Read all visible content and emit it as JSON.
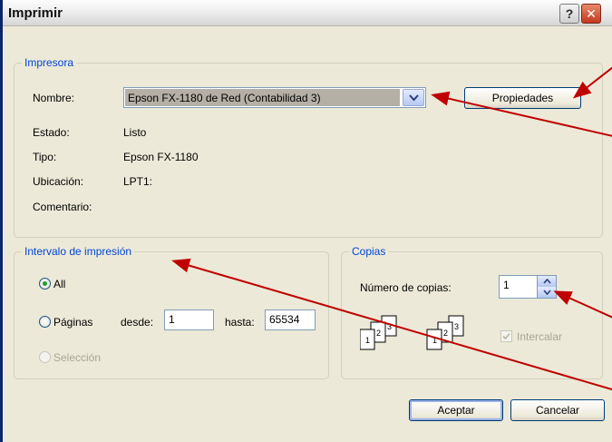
{
  "window": {
    "title": "Imprimir",
    "help_glyph": "?",
    "close_glyph": "✕"
  },
  "printer": {
    "group_label": "Impresora",
    "name_label": "Nombre:",
    "name_value": "Epson FX-1180 de Red (Contabilidad 3)",
    "properties_label": "Propiedades",
    "status_label": "Estado:",
    "status_value": "Listo",
    "type_label": "Tipo:",
    "type_value": "Epson FX-1180",
    "location_label": "Ubicación:",
    "location_value": "LPT1:",
    "comment_label": "Comentario:"
  },
  "range": {
    "group_label": "Intervalo de impresión",
    "all_label": "All",
    "pages_label": "Páginas",
    "from_label": "desde:",
    "from_value": "1",
    "to_label": "hasta:",
    "to_value": "65534",
    "selection_label": "Selección"
  },
  "copies": {
    "group_label": "Copias",
    "count_label": "Número de copias:",
    "count_value": "1",
    "collate_label": "Intercalar"
  },
  "buttons": {
    "ok_label": "Aceptar",
    "cancel_label": "Cancelar"
  },
  "colors": {
    "accent": "#0046d5",
    "arrow": "#c00000",
    "radio_selected": "#21a121"
  }
}
